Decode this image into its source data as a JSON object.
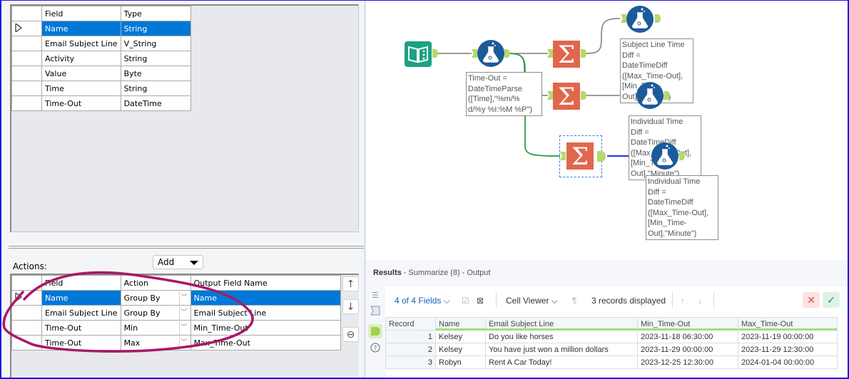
{
  "fields_grid": {
    "headers": [
      "Field",
      "Type"
    ],
    "rows": [
      {
        "field": "Name",
        "type": "String",
        "selected": true
      },
      {
        "field": "Email Subject Line",
        "type": "V_String"
      },
      {
        "field": "Activity",
        "type": "String"
      },
      {
        "field": "Value",
        "type": "Byte"
      },
      {
        "field": "Time",
        "type": "String"
      },
      {
        "field": "Time-Out",
        "type": "DateTime"
      }
    ]
  },
  "actions": {
    "label": "Actions:",
    "add_dropdown": "Add",
    "headers": [
      "Field",
      "Action",
      "Output Field Name"
    ],
    "rows": [
      {
        "field": "Name",
        "action": "Group By",
        "output": "Name",
        "selected": true
      },
      {
        "field": "Email Subject Line",
        "action": "Group By",
        "output": "Email Subject Line"
      },
      {
        "field": "Time-Out",
        "action": "Min",
        "output": "Min_Time-Out"
      },
      {
        "field": "Time-Out",
        "action": "Max",
        "output": "Max_Time-Out"
      }
    ],
    "buttons": {
      "up": "↑",
      "down": "↓",
      "remove": "⊖"
    }
  },
  "canvas": {
    "annotations": {
      "formula1": [
        "Time-Out =",
        "DateTimeParse",
        "([Time],\"%m/%",
        "d/%y %I:%M %P\")"
      ],
      "formula_subject": [
        "Subject Line Time",
        "Diff =",
        "DateTimeDiff",
        "([Max_Time-Out],",
        "[Min_Time-",
        "Out],\"Minute\")"
      ],
      "formula_individual_a": [
        "Individual Time",
        "Diff =",
        "DateTimeDiff",
        "([Max_Time-Out],",
        "[Min_Time-",
        "Out],\"Minute\")"
      ],
      "formula_individual_b": [
        "Individual Time",
        "Diff =",
        "DateTimeDiff",
        "([Max_Time-Out],",
        "[Min_Time-",
        "Out],\"Minute\")"
      ]
    },
    "colors": {
      "input_tool": "#1aa283",
      "formula_tool": "#1c5b99",
      "summarize_tool": "#e0674c",
      "anchor": "#b5d96a",
      "connection": "#7a7a7a",
      "selected_connection": "#2a9d46",
      "output_connection": "#2d2ddb"
    }
  },
  "results": {
    "title_bold": "Results",
    "title_rest": " - Summarize (8) - Output",
    "fields_selector": "4 of 4 Fields",
    "cell_viewer": "Cell Viewer",
    "records_displayed": "3 records displayed",
    "columns": [
      "Record",
      "Name",
      "Email Subject Line",
      "Min_Time-Out",
      "Max_Time-Out"
    ],
    "rows": [
      {
        "record": "1",
        "name": "Kelsey",
        "subject": "Do you like horses",
        "min": "2023-11-18 06:30:00",
        "max": "2023-11-19 00:00:00"
      },
      {
        "record": "2",
        "name": "Kelsey",
        "subject": "You have just won a million dollars",
        "min": "2023-11-29 00:00:00",
        "max": "2023-11-29 12:30:00"
      },
      {
        "record": "3",
        "name": "Robyn",
        "subject": "Rent A Car Today!",
        "min": "2023-12-25 12:30:00",
        "max": "2024-01-04 00:00:00"
      }
    ]
  }
}
